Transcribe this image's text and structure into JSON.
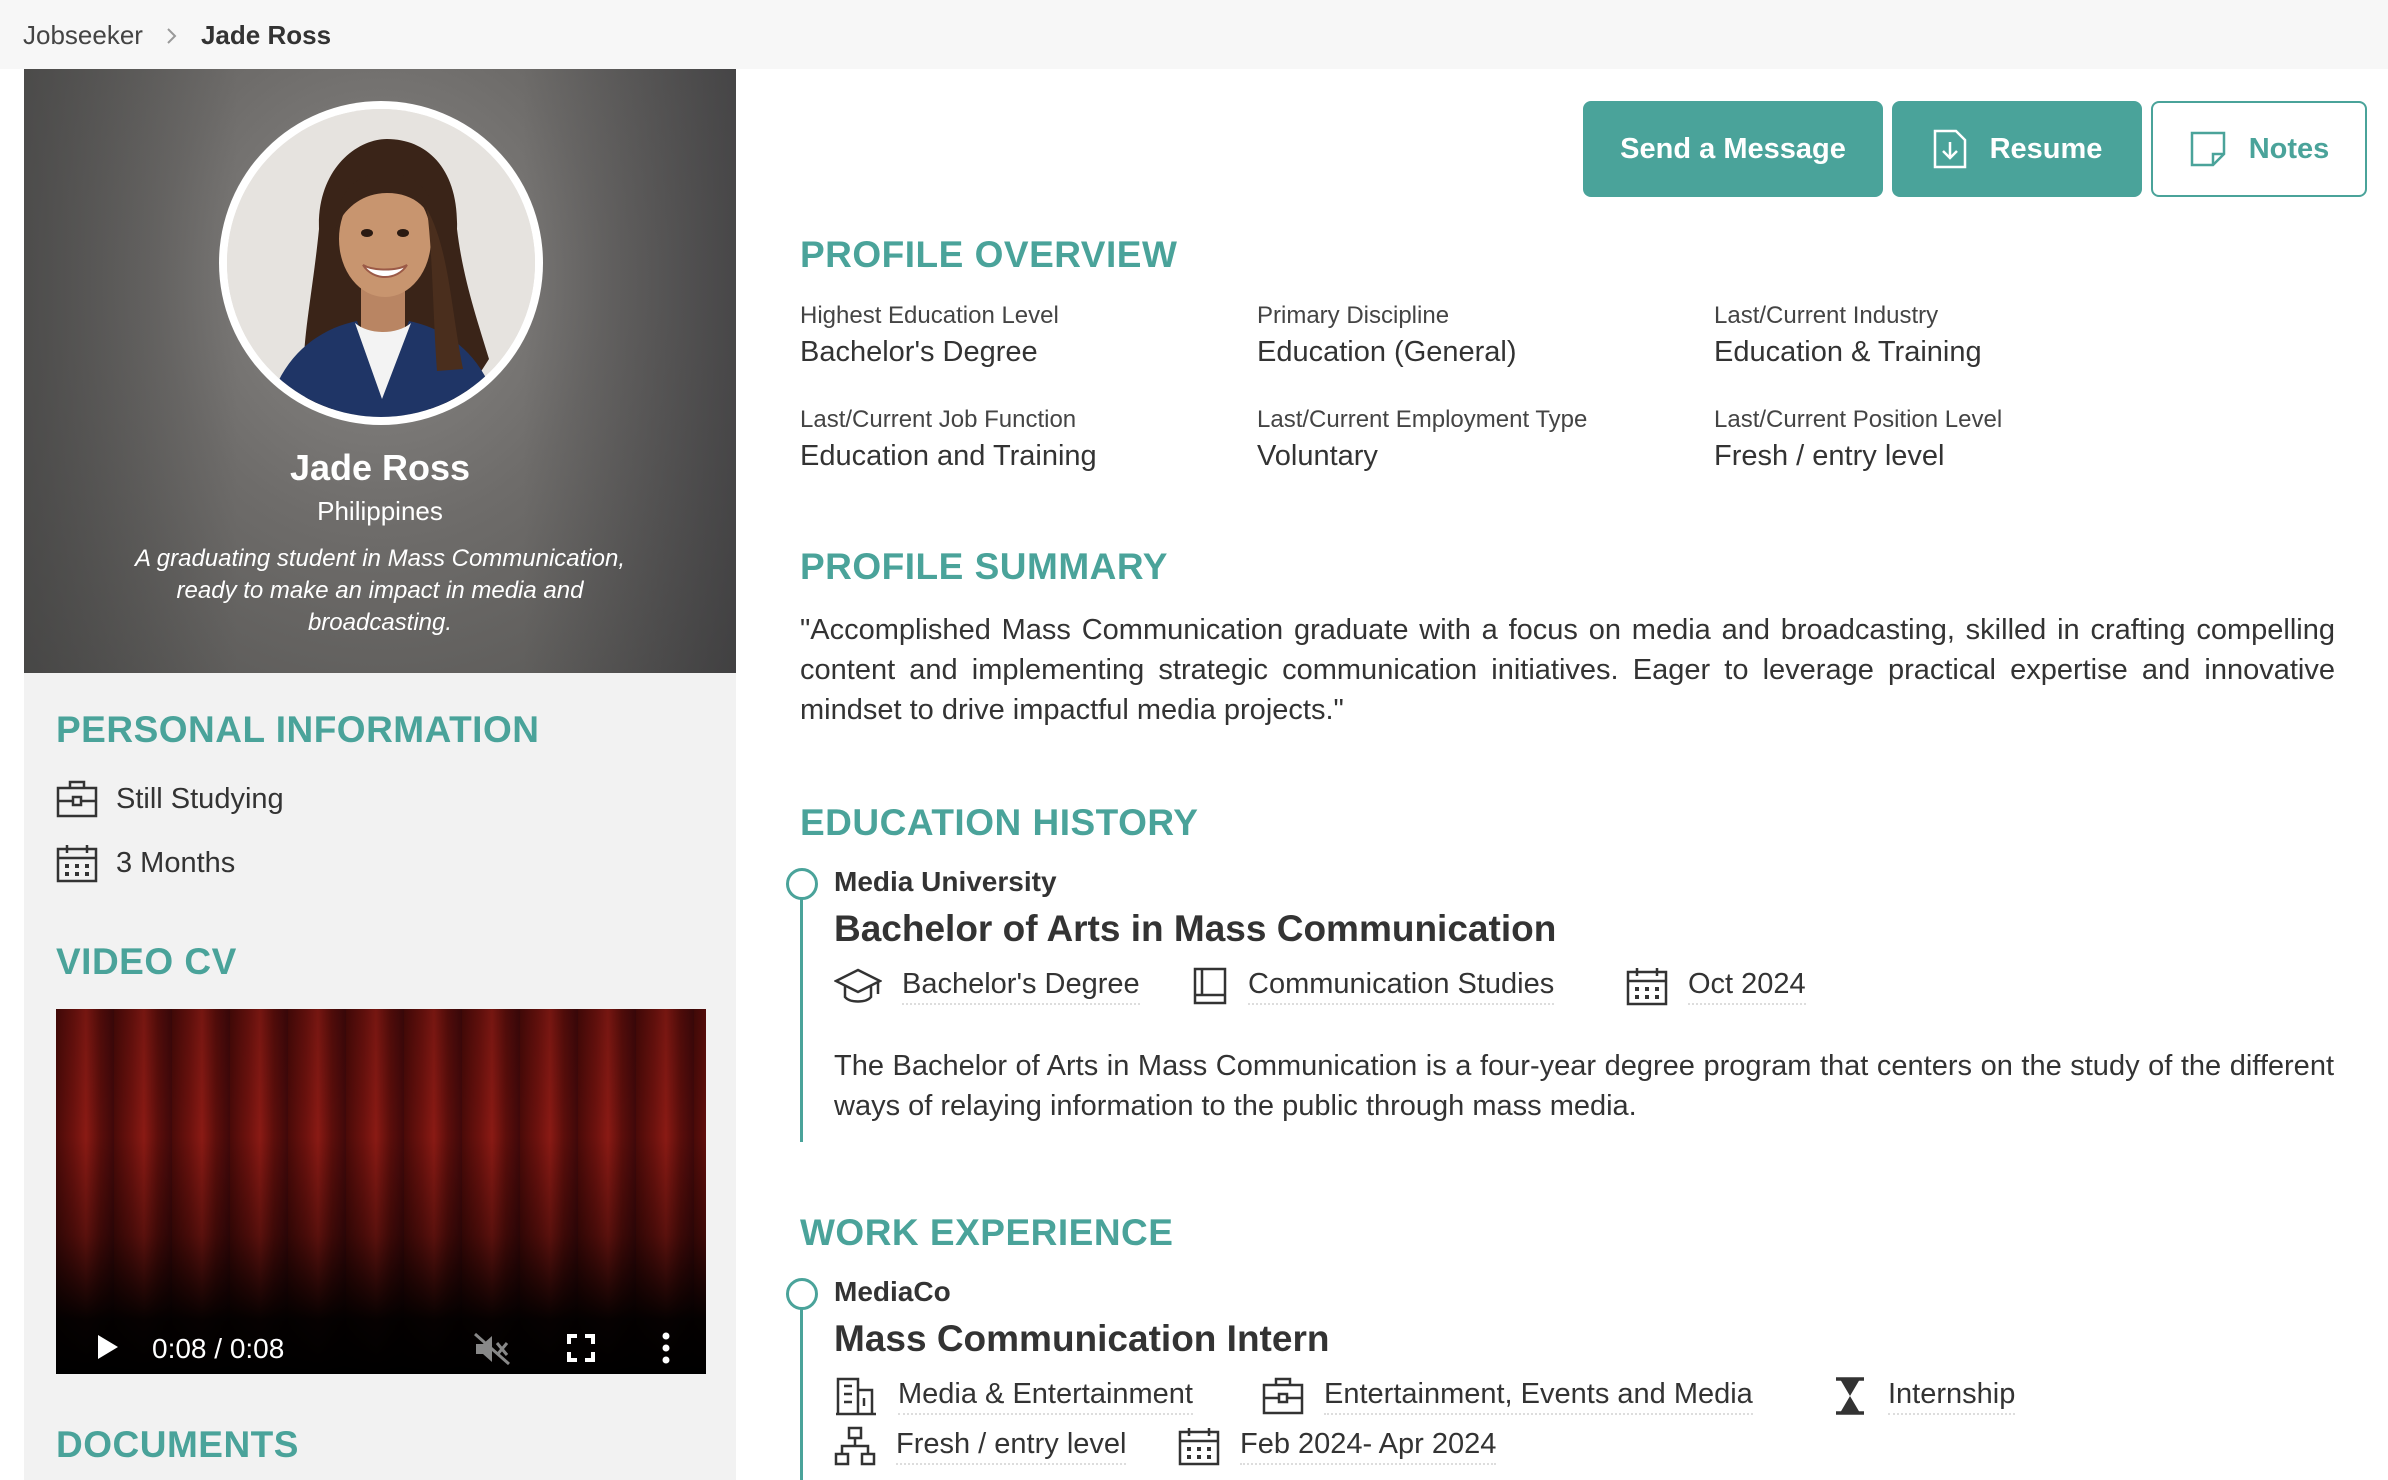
{
  "breadcrumb": {
    "parent": "Jobseeker",
    "current": "Jade Ross"
  },
  "profile": {
    "name": "Jade Ross",
    "country": "Philippines",
    "tagline": "A graduating student in Mass Communication, ready to make an impact in media and broadcasting."
  },
  "personal_information": {
    "title": "PERSONAL INFORMATION",
    "status": "Still Studying",
    "availability": "3 Months"
  },
  "video_cv": {
    "title": "VIDEO CV",
    "time": "0:08 / 0:08",
    "progress": 1.0
  },
  "documents": {
    "title": "DOCUMENTS"
  },
  "actions": {
    "message": "Send a Message",
    "resume": "Resume",
    "notes": "Notes"
  },
  "overview": {
    "title": "PROFILE OVERVIEW",
    "items": [
      {
        "label": "Highest Education Level",
        "value": "Bachelor's Degree"
      },
      {
        "label": "Primary Discipline",
        "value": "Education (General)"
      },
      {
        "label": "Last/Current Industry",
        "value": "Education & Training"
      },
      {
        "label": "Last/Current Job Function",
        "value": "Education and Training"
      },
      {
        "label": "Last/Current Employment Type",
        "value": "Voluntary"
      },
      {
        "label": "Last/Current Position Level",
        "value": "Fresh / entry level"
      }
    ]
  },
  "summary": {
    "title": "PROFILE SUMMARY",
    "text": "\"Accomplished Mass Communication graduate with a focus on media and broadcasting, skilled in crafting compelling content and implementing strategic communication initiatives. Eager to leverage practical expertise and innovative mindset to drive impactful media projects.\""
  },
  "education": {
    "title": "EDUCATION HISTORY",
    "school": "Media University",
    "degree_title": "Bachelor of Arts in Mass Communication",
    "level": "Bachelor's Degree",
    "field": "Communication Studies",
    "date": "Oct 2024",
    "description": "The Bachelor of Arts in Mass Communication is a four-year degree program that centers on the study of the different ways of relaying information to the public through mass media."
  },
  "work": {
    "title": "WORK EXPERIENCE",
    "company": "MediaCo",
    "position": "Mass Communication Intern",
    "industry": "Media & Entertainment",
    "function": "Entertainment, Events and Media",
    "type": "Internship",
    "level": "Fresh / entry level",
    "dates": "Feb 2024- Apr 2024"
  },
  "colors": {
    "accent": "#4aa39a",
    "panel": "#f2f2f2"
  }
}
